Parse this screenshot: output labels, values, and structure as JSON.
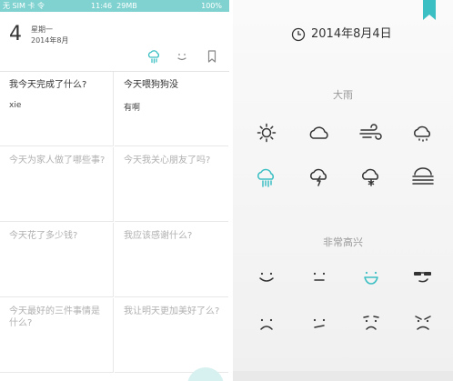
{
  "status_bar": {
    "carrier": "无 SIM 卡 令",
    "time": "11:46",
    "network": "29MB",
    "battery": "100%"
  },
  "diary": {
    "day": "4",
    "weekday": "星期一",
    "date": "2014年8月",
    "toolbar_icons": [
      "weather-icon",
      "mood-icon",
      "bookmark-icon"
    ],
    "accent_color": "#3cbfc3",
    "cells": [
      {
        "question": "我今天完成了什么?",
        "answer": "xie",
        "filled": true
      },
      {
        "question": "今天喂狗狗没",
        "answer": "有啊",
        "filled": true
      },
      {
        "question": "今天为家人做了哪些事?",
        "answer": "",
        "filled": false
      },
      {
        "question": "今天我关心朋友了吗?",
        "answer": "",
        "filled": false
      },
      {
        "question": "今天花了多少钱?",
        "answer": "",
        "filled": false
      },
      {
        "question": "我应该感谢什么?",
        "answer": "",
        "filled": false
      },
      {
        "question": "今天最好的三件事情是什么?",
        "answer": "",
        "filled": false
      },
      {
        "question": "我让明天更加美好了么?",
        "answer": "",
        "filled": false
      }
    ]
  },
  "picker": {
    "date": "2014年8月4日",
    "weather_label": "大雨",
    "weather_icons": [
      "sunny",
      "cloudy",
      "windy",
      "light-rain",
      "heavy-rain",
      "thunderstorm",
      "snow",
      "fog"
    ],
    "weather_selected": "heavy-rain",
    "mood_label": "非常高兴",
    "mood_icons": [
      "smile",
      "neutral",
      "very-happy",
      "cool",
      "sad",
      "smirk",
      "worried",
      "angry"
    ],
    "mood_selected": "very-happy",
    "accent_color": "#3cbfc3"
  }
}
